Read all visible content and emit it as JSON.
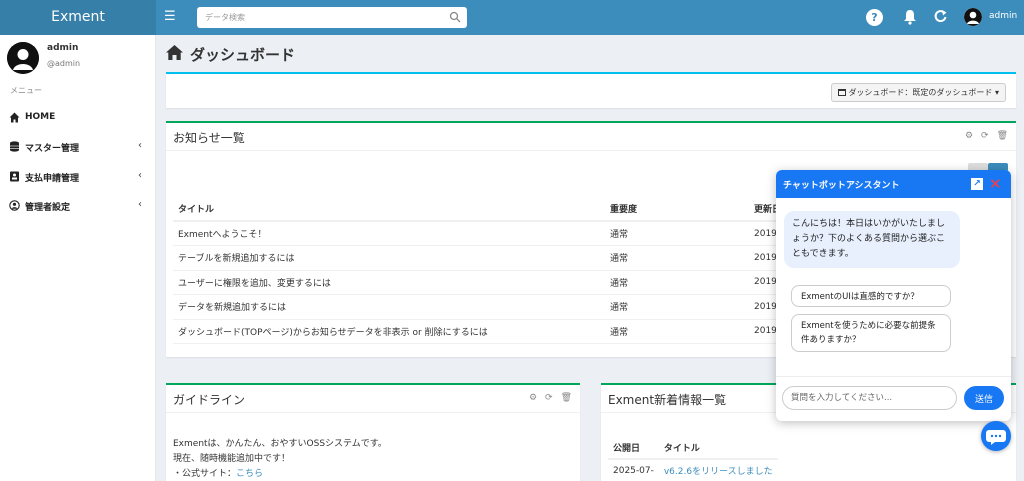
{
  "brand": "Exment",
  "search": {
    "placeholder": "データ検索"
  },
  "top": {
    "help": "?",
    "username": "admin"
  },
  "sidebar": {
    "name": "admin",
    "handle": "@admin",
    "menu_header": "メニュー",
    "items": [
      {
        "label": "HOME",
        "icon": "home-icon"
      },
      {
        "label": "マスター管理",
        "icon": "database-icon"
      },
      {
        "label": "支払申請管理",
        "icon": "id-card-icon"
      },
      {
        "label": "管理者設定",
        "icon": "user-circle-icon"
      }
    ]
  },
  "page": {
    "title": "ダッシュボード"
  },
  "dashboard_select": "ダッシュボード：既定のダッシュボード",
  "news": {
    "title": "お知らせ一覧",
    "columns": [
      "タイトル",
      "重要度",
      "更新日"
    ],
    "rows": [
      {
        "title": "Exmentへようこそ！",
        "importance": "通常",
        "date": "2019-"
      },
      {
        "title": "テーブルを新規追加するには",
        "importance": "通常",
        "date": "2019-"
      },
      {
        "title": "ユーザーに権限を追加、変更するには",
        "importance": "通常",
        "date": "2019-"
      },
      {
        "title": "データを新規追加するには",
        "importance": "通常",
        "date": "2019-"
      },
      {
        "title": "ダッシュボード(TOPページ)からお知らせデータを非表示 or 削除にするには",
        "importance": "通常",
        "date": "2019-"
      }
    ]
  },
  "guide": {
    "title": "ガイドライン",
    "line1": "Exmentは、かんたん、おやすいOSSシステムです。",
    "line2": "現在、随時機能追加中です！",
    "line3_prefix": "・公式サイト：",
    "line3_link": "こちら"
  },
  "info": {
    "title": "Exment新着情報一覧",
    "columns": [
      "公開日",
      "タイトル"
    ],
    "rows": [
      {
        "date": "2025-07-",
        "title": "v6.2.6をリリースしました"
      }
    ]
  },
  "chat": {
    "title": "チャットボットアシスタント",
    "expand": "↗",
    "close": "✕",
    "greeting": "こんにちは！本日はいかがいたしましょうか？下のよくある質問から選ぶこともできます。",
    "question1": "ExmentのUIは直感的ですか？",
    "question2": "Exmentを使うために必要な前提条件ありますか？",
    "input_placeholder": "質問を入力してください...",
    "send_label": "送信"
  },
  "colors": {
    "topbar": "#3c8dbc",
    "brand": "#367fa9",
    "box_accent": "#00a65a",
    "chat_accent": "#1877f2"
  }
}
